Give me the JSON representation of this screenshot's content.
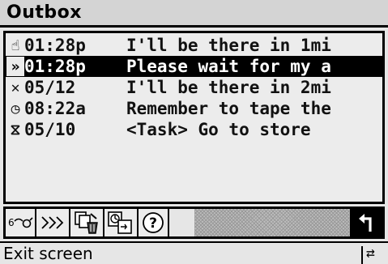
{
  "window": {
    "title": "Outbox"
  },
  "messages": [
    {
      "icon": "hand-sent-icon",
      "glyph": "☝",
      "time": "01:28p",
      "text": "I'll be there in 1mi",
      "selected": false
    },
    {
      "icon": "sending-chevrons-icon",
      "glyph": "»",
      "time": "01:28p",
      "text": "Please wait for my a",
      "selected": true
    },
    {
      "icon": "failed-x-icon",
      "glyph": "✕",
      "time": "05/12 ",
      "text": "I'll be there in 2mi",
      "selected": false
    },
    {
      "icon": "clock-icon",
      "glyph": "◷",
      "time": "08:22a",
      "text": "Remember to tape the",
      "selected": false
    },
    {
      "icon": "hourglass-icon",
      "glyph": "⧖",
      "time": "05/10 ",
      "text": "<Task> Go to store",
      "selected": false
    }
  ],
  "toolbar": {
    "buttons": [
      {
        "name": "read-glasses-button",
        "icon": "glasses-icon",
        "glyph": "6⌒σ"
      },
      {
        "name": "send-button",
        "icon": "chevrons-icon",
        "glyph": "»›"
      },
      {
        "name": "delete-button",
        "icon": "pages-trash-icon",
        "glyph": "⎙"
      },
      {
        "name": "schedule-button",
        "icon": "clock-pages-icon",
        "glyph": "◷"
      },
      {
        "name": "help-button",
        "icon": "question-icon",
        "glyph": "?"
      }
    ],
    "back_glyph": "↰"
  },
  "status": {
    "text": "Exit screen",
    "keyboard_glyph": "⇄"
  }
}
